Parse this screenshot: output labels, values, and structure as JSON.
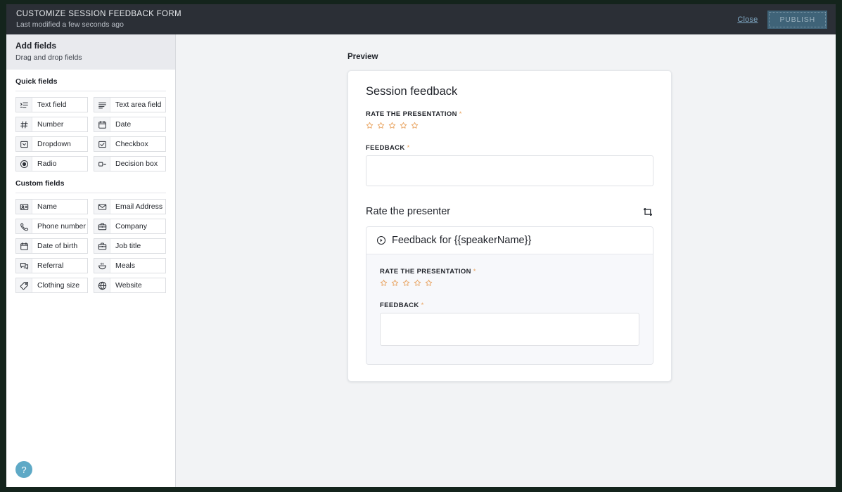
{
  "topbar": {
    "title": "CUSTOMIZE SESSION FEEDBACK FORM",
    "subtitle": "Last modified a few seconds ago",
    "close_label": "Close",
    "publish_label": "PUBLISH"
  },
  "sidebar": {
    "title": "Add fields",
    "subtitle": "Drag and drop fields",
    "groups": [
      {
        "title": "Quick fields",
        "items": [
          {
            "label": "Text field",
            "icon": "text-field-icon"
          },
          {
            "label": "Text area field",
            "icon": "text-area-icon"
          },
          {
            "label": "Number",
            "icon": "hash-icon"
          },
          {
            "label": "Date",
            "icon": "calendar-icon"
          },
          {
            "label": "Dropdown",
            "icon": "dropdown-icon"
          },
          {
            "label": "Checkbox",
            "icon": "checkbox-icon"
          },
          {
            "label": "Radio",
            "icon": "radio-icon"
          },
          {
            "label": "Decision box",
            "icon": "decision-box-icon"
          }
        ]
      },
      {
        "title": "Custom fields",
        "items": [
          {
            "label": "Name",
            "icon": "id-card-icon"
          },
          {
            "label": "Email Address",
            "icon": "envelope-icon"
          },
          {
            "label": "Phone number",
            "icon": "phone-icon"
          },
          {
            "label": "Company",
            "icon": "briefcase-icon"
          },
          {
            "label": "Date of birth",
            "icon": "calendar-icon"
          },
          {
            "label": "Job title",
            "icon": "briefcase-icon"
          },
          {
            "label": "Referral",
            "icon": "chat-bubbles-icon"
          },
          {
            "label": "Meals",
            "icon": "bowl-icon"
          },
          {
            "label": "Clothing size",
            "icon": "tag-icon"
          },
          {
            "label": "Website",
            "icon": "globe-icon"
          }
        ]
      }
    ]
  },
  "main": {
    "preview_label": "Preview",
    "form_title": "Session feedback",
    "rating_label": "RATE THE PRESENTATION",
    "feedback_label": "FEEDBACK",
    "required_mark": "*",
    "star_count": 5,
    "rating_value": 0,
    "feedback_value": "",
    "repeat_section": {
      "title": "Rate the presenter",
      "icon": "repeat-icon",
      "nested": {
        "header_icon": "circle-chevron-icon",
        "header_title": "Feedback for {{speakerName}}",
        "rating_label": "RATE THE PRESENTATION",
        "feedback_label": "FEEDBACK",
        "star_count": 5,
        "rating_value": 0,
        "feedback_value": ""
      }
    }
  },
  "help": {
    "label": "?"
  },
  "colors": {
    "accent_orange": "#e8a15c",
    "topbar_bg": "#2b2f36",
    "publish_bg": "#3f6378",
    "link_blue": "#7fa8c4",
    "help_blue": "#5ea9c6"
  }
}
